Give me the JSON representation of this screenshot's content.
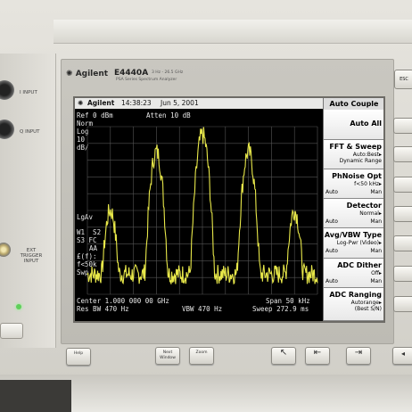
{
  "instrument": {
    "brand": "Agilent",
    "model": "E4440A",
    "freq_range": "3 Hz - 26.5 GHz",
    "series": "PSA Series Spectrum Analyzer"
  },
  "left_panel": {
    "i_input": "I INPUT",
    "q_input": "Q INPUT",
    "ext_trigger": "EXT\nTRIGGER\nINPUT"
  },
  "status": {
    "brand": "Agilent",
    "time": "14:38:23",
    "date": "Jun 5, 2001"
  },
  "display": {
    "ref": "Ref 0 dBm",
    "atten": "Atten 10 dB",
    "norm": "Norm",
    "log": "Log",
    "scale": "10",
    "scale_unit": "dB/",
    "lgav": "LgAv",
    "w1s2": "W1  S2",
    "s3fc": "S3 FC",
    "aa": "AA",
    "ef": "£(f):",
    "f50k": "f<50k",
    "swp": "Swp",
    "center": "Center 1.000 000 00 GHz",
    "span": "Span 50 kHz",
    "res_bw": "Res BW 470 Hz",
    "vbw": "VBW 470 Hz",
    "sweep": "Sweep 272.9 ms",
    "trace_color": "#e8e84a",
    "peaks_db": [
      -50,
      -15,
      -5,
      -15,
      -50
    ],
    "noise_floor_db": -88
  },
  "menu": {
    "title": "Auto Couple",
    "keys": [
      {
        "label": "Auto All",
        "sub": "",
        "left": "",
        "right": ""
      },
      {
        "label": "FFT & Sweep",
        "sub": "Auto:Best▸",
        "sub2": "Dynamic Range",
        "left": "",
        "right": ""
      },
      {
        "label": "PhNoise Opt",
        "sub": "f<50 kHz▸",
        "left": "Auto",
        "right": "Man"
      },
      {
        "label": "Detector",
        "sub": "Normal▸",
        "left": "Auto",
        "right": "Man"
      },
      {
        "label": "Avg/VBW Type",
        "sub": "Log-Pwr (Video)▸",
        "left": "Auto",
        "right": "Man"
      },
      {
        "label": "ADC Dither",
        "sub": "Off▸",
        "left": "Auto",
        "right": "Man"
      },
      {
        "label": "ADC Ranging",
        "sub": "Autorange▸",
        "sub2": "(Best S/N)",
        "left": "",
        "right": ""
      }
    ]
  },
  "front_buttons": {
    "help": "Help",
    "next_window": "Next Window",
    "zoom": "Zoom",
    "esc": "ESC"
  }
}
